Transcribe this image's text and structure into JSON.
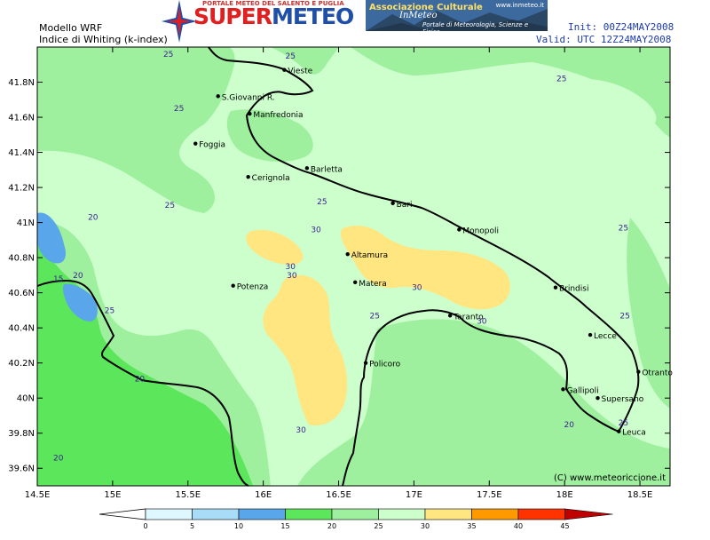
{
  "header": {
    "model": "Modello WRF",
    "index": "Indice di Whiting (k-index)",
    "init": "Init: 00Z24MAY2008",
    "valid": "Valid: UTC 12Z24MAY2008"
  },
  "logo": {
    "part1": "SUPER",
    "part2": "METEO",
    "subtitle": "PORTALE METEO DEL SALENTO E PUGLIA"
  },
  "banner": {
    "title": "Associazione Culturale",
    "script": "InMeteo",
    "url": "www.inmeteo.it",
    "subtitle": "Portale di Meteorologia, Scienze e Fisica"
  },
  "map": {
    "cities": [
      {
        "name": "Vieste",
        "lon": 16.14,
        "lat": 41.87
      },
      {
        "name": "S.Giovanni R.",
        "lon": 15.7,
        "lat": 41.72
      },
      {
        "name": "Manfredonia",
        "lon": 15.91,
        "lat": 41.62
      },
      {
        "name": "Foggia",
        "lon": 15.55,
        "lat": 41.45
      },
      {
        "name": "Barletta",
        "lon": 16.29,
        "lat": 41.31
      },
      {
        "name": "Cerignola",
        "lon": 15.9,
        "lat": 41.26
      },
      {
        "name": "Bari",
        "lon": 16.86,
        "lat": 41.11
      },
      {
        "name": "Monopoli",
        "lon": 17.3,
        "lat": 40.96
      },
      {
        "name": "Altamura",
        "lon": 16.56,
        "lat": 40.82
      },
      {
        "name": "Brindisi",
        "lon": 17.94,
        "lat": 40.63
      },
      {
        "name": "Potenza",
        "lon": 15.8,
        "lat": 40.64
      },
      {
        "name": "Matera",
        "lon": 16.61,
        "lat": 40.66
      },
      {
        "name": "Taranto",
        "lon": 17.24,
        "lat": 40.47
      },
      {
        "name": "Lecce",
        "lon": 18.17,
        "lat": 40.36
      },
      {
        "name": "Policoro",
        "lon": 16.68,
        "lat": 40.2
      },
      {
        "name": "Otranto",
        "lon": 18.49,
        "lat": 40.15
      },
      {
        "name": "Gallipoli",
        "lon": 17.99,
        "lat": 40.05
      },
      {
        "name": "Supersano",
        "lon": 18.22,
        "lat": 40.0
      },
      {
        "name": "Leuca",
        "lon": 18.36,
        "lat": 39.81
      }
    ],
    "contour_labels": [
      {
        "text": "25",
        "lon": 15.37,
        "lat": 41.96
      },
      {
        "text": "25",
        "lon": 16.18,
        "lat": 41.95
      },
      {
        "text": "25",
        "lon": 15.44,
        "lat": 41.65
      },
      {
        "text": "25",
        "lon": 17.98,
        "lat": 41.82
      },
      {
        "text": "25",
        "lon": 15.38,
        "lat": 41.1
      },
      {
        "text": "25",
        "lon": 16.39,
        "lat": 41.12
      },
      {
        "text": "25",
        "lon": 18.39,
        "lat": 40.97
      },
      {
        "text": "25",
        "lon": 14.98,
        "lat": 40.5
      },
      {
        "text": "25",
        "lon": 16.74,
        "lat": 40.47
      },
      {
        "text": "25",
        "lon": 18.4,
        "lat": 40.47
      },
      {
        "text": "25",
        "lon": 18.39,
        "lat": 39.86
      },
      {
        "text": "20",
        "lon": 14.87,
        "lat": 41.03
      },
      {
        "text": "20",
        "lon": 14.77,
        "lat": 40.7
      },
      {
        "text": "20",
        "lon": 15.18,
        "lat": 40.11
      },
      {
        "text": "20",
        "lon": 14.64,
        "lat": 39.66
      },
      {
        "text": "20",
        "lon": 18.03,
        "lat": 39.85
      },
      {
        "text": "15",
        "lon": 14.64,
        "lat": 40.68
      },
      {
        "text": "30",
        "lon": 16.35,
        "lat": 40.96
      },
      {
        "text": "30",
        "lon": 16.18,
        "lat": 40.75
      },
      {
        "text": "30",
        "lon": 16.19,
        "lat": 40.7
      },
      {
        "text": "30",
        "lon": 17.02,
        "lat": 40.63
      },
      {
        "text": "30",
        "lon": 17.45,
        "lat": 40.44
      },
      {
        "text": "30",
        "lon": 16.25,
        "lat": 39.82
      }
    ],
    "axis_x": {
      "labels": [
        "14.5E",
        "15E",
        "15.5E",
        "16E",
        "16.5E",
        "17E",
        "17.5E",
        "18E",
        "18.5E"
      ],
      "lon_values": [
        14.5,
        15,
        15.5,
        16,
        16.5,
        17,
        17.5,
        18,
        18.5
      ]
    },
    "axis_y": {
      "labels": [
        "39.6N",
        "39.8N",
        "40N",
        "40.2N",
        "40.4N",
        "40.6N",
        "40.8N",
        "41N",
        "41.2N",
        "41.4N",
        "41.6N",
        "41.8N"
      ],
      "lat_values": [
        39.6,
        39.8,
        40.0,
        40.2,
        40.4,
        40.6,
        40.8,
        41.0,
        41.2,
        41.4,
        41.6,
        41.8
      ]
    },
    "lon_range": [
      14.5,
      18.7
    ],
    "lat_range": [
      39.5,
      42.0
    ],
    "copyright": "(C) www.meteoriccione.it"
  },
  "legend": {
    "ticks": [
      "0",
      "5",
      "10",
      "15",
      "20",
      "25",
      "30",
      "35",
      "40",
      "45"
    ],
    "colors": [
      "#dff7ff",
      "#a9dcf7",
      "#5aa6ea",
      "#5ce65c",
      "#9ef09e",
      "#ccffcc",
      "#ffe680",
      "#ff9900",
      "#ff3300",
      "#c00000"
    ]
  }
}
